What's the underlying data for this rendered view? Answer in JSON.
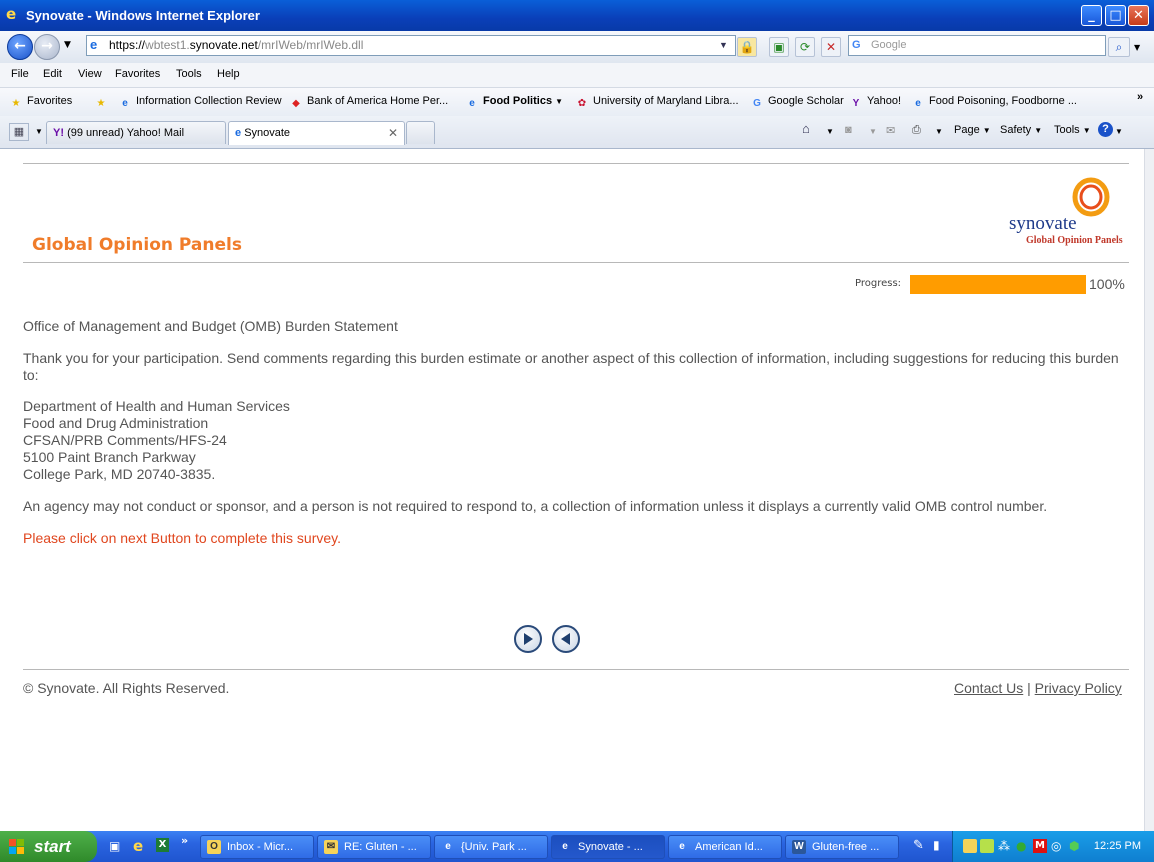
{
  "window": {
    "title": "Synovate - Windows Internet Explorer"
  },
  "address": {
    "scheme": "https://",
    "host_prefix": "wbtest1.",
    "host": "synovate.net",
    "path": "/mrIWeb/mrIWeb.dll"
  },
  "search": {
    "placeholder": "Google"
  },
  "menu": [
    "File",
    "Edit",
    "View",
    "Favorites",
    "Tools",
    "Help"
  ],
  "favorites": {
    "label": "Favorites",
    "items": [
      "Information Collection Review",
      "Bank of America  Home  Per...",
      "Food Politics",
      "University of Maryland Libra...",
      "Google Scholar",
      "Yahoo!",
      "Food Poisoning, Foodborne ..."
    ]
  },
  "tabs": [
    {
      "label": "(99 unread) Yahoo! Mail"
    },
    {
      "label": "Synovate"
    }
  ],
  "commands": [
    "Page",
    "Safety",
    "Tools"
  ],
  "page": {
    "header": "Global Opinion Panels",
    "logo": {
      "word": "synovate",
      "tagline": "Global Opinion Panels"
    },
    "progress": {
      "label": "Progress:",
      "value": 100,
      "text": "100%"
    },
    "burden_title": "Office of Management and Budget (OMB) Burden Statement",
    "thanks": "Thank you for your participation. Send comments regarding this burden estimate or another aspect of this collection of information, including suggestions for reducing this burden to:",
    "address_lines": [
      "Department of Health and Human Services",
      "Food and Drug Administration",
      "CFSAN/PRB Comments/HFS-24",
      "5100 Paint Branch Parkway",
      "College Park, MD 20740-3835."
    ],
    "agency_notice": "An agency may not conduct or sponsor, and a person is not required to respond to, a collection of information unless it displays a currently valid OMB control number.",
    "instruction": "Please click on next Button to complete this survey.",
    "footer": {
      "copyright": "© Synovate. All Rights Reserved.",
      "contact": "Contact Us",
      "separator": "|",
      "privacy": "Privacy Policy"
    }
  },
  "taskbar": {
    "start": "start",
    "tasks": [
      "Inbox - Micr...",
      "RE: Gluten - ...",
      "{Univ. Park ...",
      "Synovate - ...",
      "American Id...",
      "Gluten-free ..."
    ],
    "clock": "12:25 PM"
  },
  "colors": {
    "accent_orange": "#f07c2a",
    "progress": "#ff9c00",
    "instruction_red": "#e0461e",
    "logo_blue": "#1e3a8a"
  }
}
